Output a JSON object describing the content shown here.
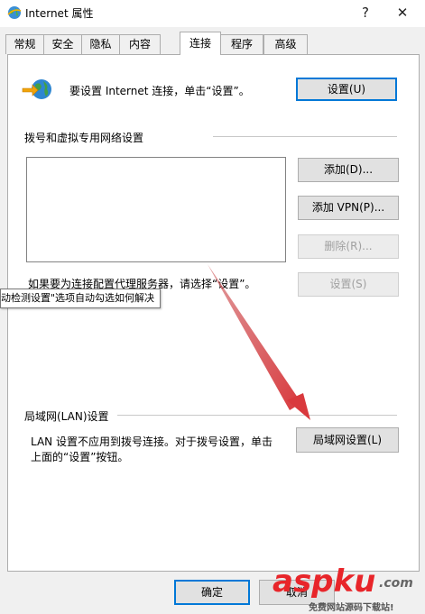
{
  "window": {
    "title": "Internet 属性",
    "help_button": "?",
    "close_button": "✕"
  },
  "tabs": [
    {
      "label": "常规"
    },
    {
      "label": "安全"
    },
    {
      "label": "隐私"
    },
    {
      "label": "内容"
    },
    {
      "label": "连接",
      "active": true
    },
    {
      "label": "程序"
    },
    {
      "label": "高级"
    }
  ],
  "setup": {
    "text": "要设置 Internet 连接，单击“设置”。",
    "button": "设置(U)"
  },
  "dialup": {
    "section_label": "拨号和虚拟专用网络设置",
    "add_button": "添加(D)...",
    "add_vpn_button": "添加 VPN(P)...",
    "remove_button": "删除(R)...",
    "settings_button": "设置(S)",
    "proxy_text": "如果要为连接配置代理服务器，请选择“设置”。"
  },
  "tooltip": {
    "text": "动检测设置\"选项自动勾选如何解决"
  },
  "lan": {
    "section_label": "局域网(LAN)设置",
    "text_line1": "LAN 设置不应用到拨号连接。对于拨号设置，单击",
    "text_line2": "上面的“设置”按钮。",
    "button": "局域网设置(L)"
  },
  "footer": {
    "ok_button": "确定",
    "cancel_button": "取消"
  },
  "watermark": {
    "brand": "aspku",
    "brand_com": ".com",
    "tagline": "免费网站源码下载站!"
  },
  "colors": {
    "arrow": "#d9393d",
    "watermark_red": "#e8252a",
    "focus_blue": "#0078d7"
  }
}
